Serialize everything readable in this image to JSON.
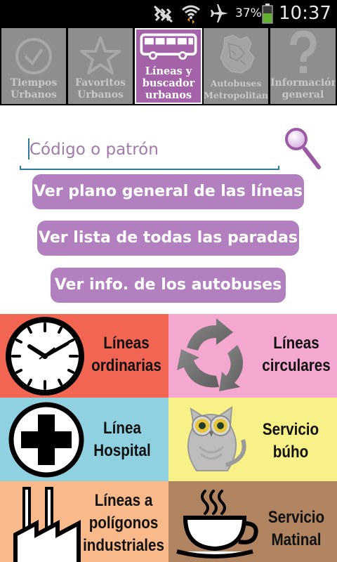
{
  "status_bar": {
    "battery_percent": "37%",
    "time": "10:37",
    "icons": [
      "mute-icon",
      "wifi-icon",
      "airplane-mode-icon",
      "battery-icon"
    ]
  },
  "tabs": [
    {
      "label": "Tiempos\nUrbanos",
      "icon": "clock-icon",
      "active": false
    },
    {
      "label": "Favoritos\nUrbanos",
      "icon": "star-icon",
      "active": false
    },
    {
      "label": "Líneas y\nbuscador\nurbanos",
      "icon": "bus-icon",
      "active": true
    },
    {
      "label": "Autobuses\nMetropolitanos",
      "icon": "region-map-icon",
      "active": false
    },
    {
      "label": "Información\ngeneral",
      "icon": "question-mark-icon",
      "active": false
    }
  ],
  "search": {
    "placeholder": "Código o patrón",
    "button_icon": "magnifier-icon"
  },
  "buttons": {
    "general_map": "Ver plano general de las líneas",
    "all_stops": "Ver lista de todas las paradas",
    "bus_info": "Ver info. de los autobuses"
  },
  "categories": [
    {
      "label": "Líneas\nordinarias",
      "icon": "clock-icon",
      "color": "#f26552"
    },
    {
      "label": "Líneas\ncirculares",
      "icon": "circular-arrows-icon",
      "color": "#f5a8cf"
    },
    {
      "label": "Línea\nHospital",
      "icon": "hospital-cross-icon",
      "color": "#8fd1e0"
    },
    {
      "label": "Servicio\nbúho",
      "icon": "owl-icon",
      "color": "#f8f188"
    },
    {
      "label": "Líneas a\npolígonos\nindustriales",
      "icon": "factory-icon",
      "color": "#f9b98a"
    },
    {
      "label": "Servicio\nMatinal",
      "icon": "coffee-cup-icon",
      "color": "#b08361"
    }
  ],
  "colors": {
    "accent": "#a463a8",
    "button": "#b27fbf",
    "tab_inactive": "#8e8e8e"
  }
}
